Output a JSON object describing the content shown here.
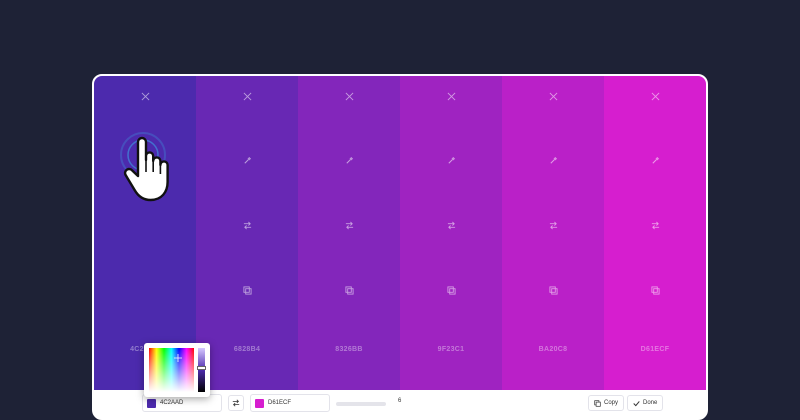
{
  "colors": {
    "background": "#1e2236",
    "panel": "#ffffff"
  },
  "palette": [
    {
      "hex": "4C2AAD",
      "color": "#4c2aad"
    },
    {
      "hex": "6828B4",
      "color": "#6828b4"
    },
    {
      "hex": "8326BB",
      "color": "#8326bb"
    },
    {
      "hex": "9F23C1",
      "color": "#9f23c1"
    },
    {
      "hex": "BA20C8",
      "color": "#ba20c8"
    },
    {
      "hex": "D61ECF",
      "color": "#d61ecf"
    }
  ],
  "swatch_icons": [
    "close-icon",
    "eyedropper-icon",
    "swap-icon",
    "copy-icon"
  ],
  "bottom_bar": {
    "start_color": {
      "hex": "4C2AAD",
      "color": "#4c2aad"
    },
    "end_color": {
      "hex": "D61ECF",
      "color": "#d61ecf"
    },
    "steps_value": "6",
    "copy_label": "Copy",
    "done_label": "Done"
  }
}
